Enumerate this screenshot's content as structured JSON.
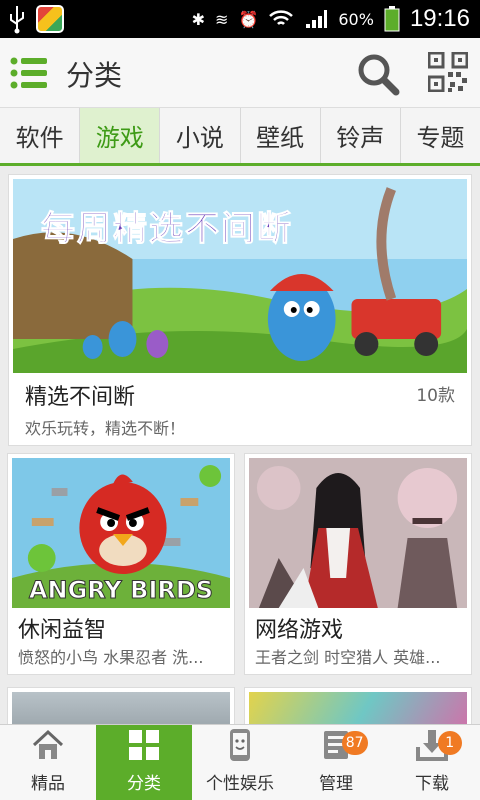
{
  "status_bar": {
    "battery": "60%",
    "time": "19:16"
  },
  "header": {
    "title": "分类"
  },
  "tabs": [
    {
      "label": "软件",
      "active": false
    },
    {
      "label": "游戏",
      "active": true
    },
    {
      "label": "小说",
      "active": false
    },
    {
      "label": "壁纸",
      "active": false
    },
    {
      "label": "铃声",
      "active": false
    },
    {
      "label": "专题",
      "active": false
    }
  ],
  "featured": {
    "banner_text": "每周精选不间断",
    "title": "精选不间断",
    "count": "10款",
    "desc": "欢乐玩转，精选不断！"
  },
  "categories": [
    {
      "title": "休闲益智",
      "desc": "愤怒的小鸟 水果忍者 洗...",
      "art_text": "ANGRY BIRDS"
    },
    {
      "title": "网络游戏",
      "desc": "王者之剑 时空猎人 英雄..."
    }
  ],
  "bottom_nav": [
    {
      "label": "精品",
      "icon": "house-icon",
      "badge": ""
    },
    {
      "label": "分类",
      "icon": "grid-icon",
      "badge": ""
    },
    {
      "label": "个性娱乐",
      "icon": "phone-icon",
      "badge": ""
    },
    {
      "label": "管理",
      "icon": "manage-icon",
      "badge": "87"
    },
    {
      "label": "下载",
      "icon": "download-icon",
      "badge": "1"
    }
  ],
  "colors": {
    "accent": "#5cad2a",
    "badge": "#f07a23"
  }
}
